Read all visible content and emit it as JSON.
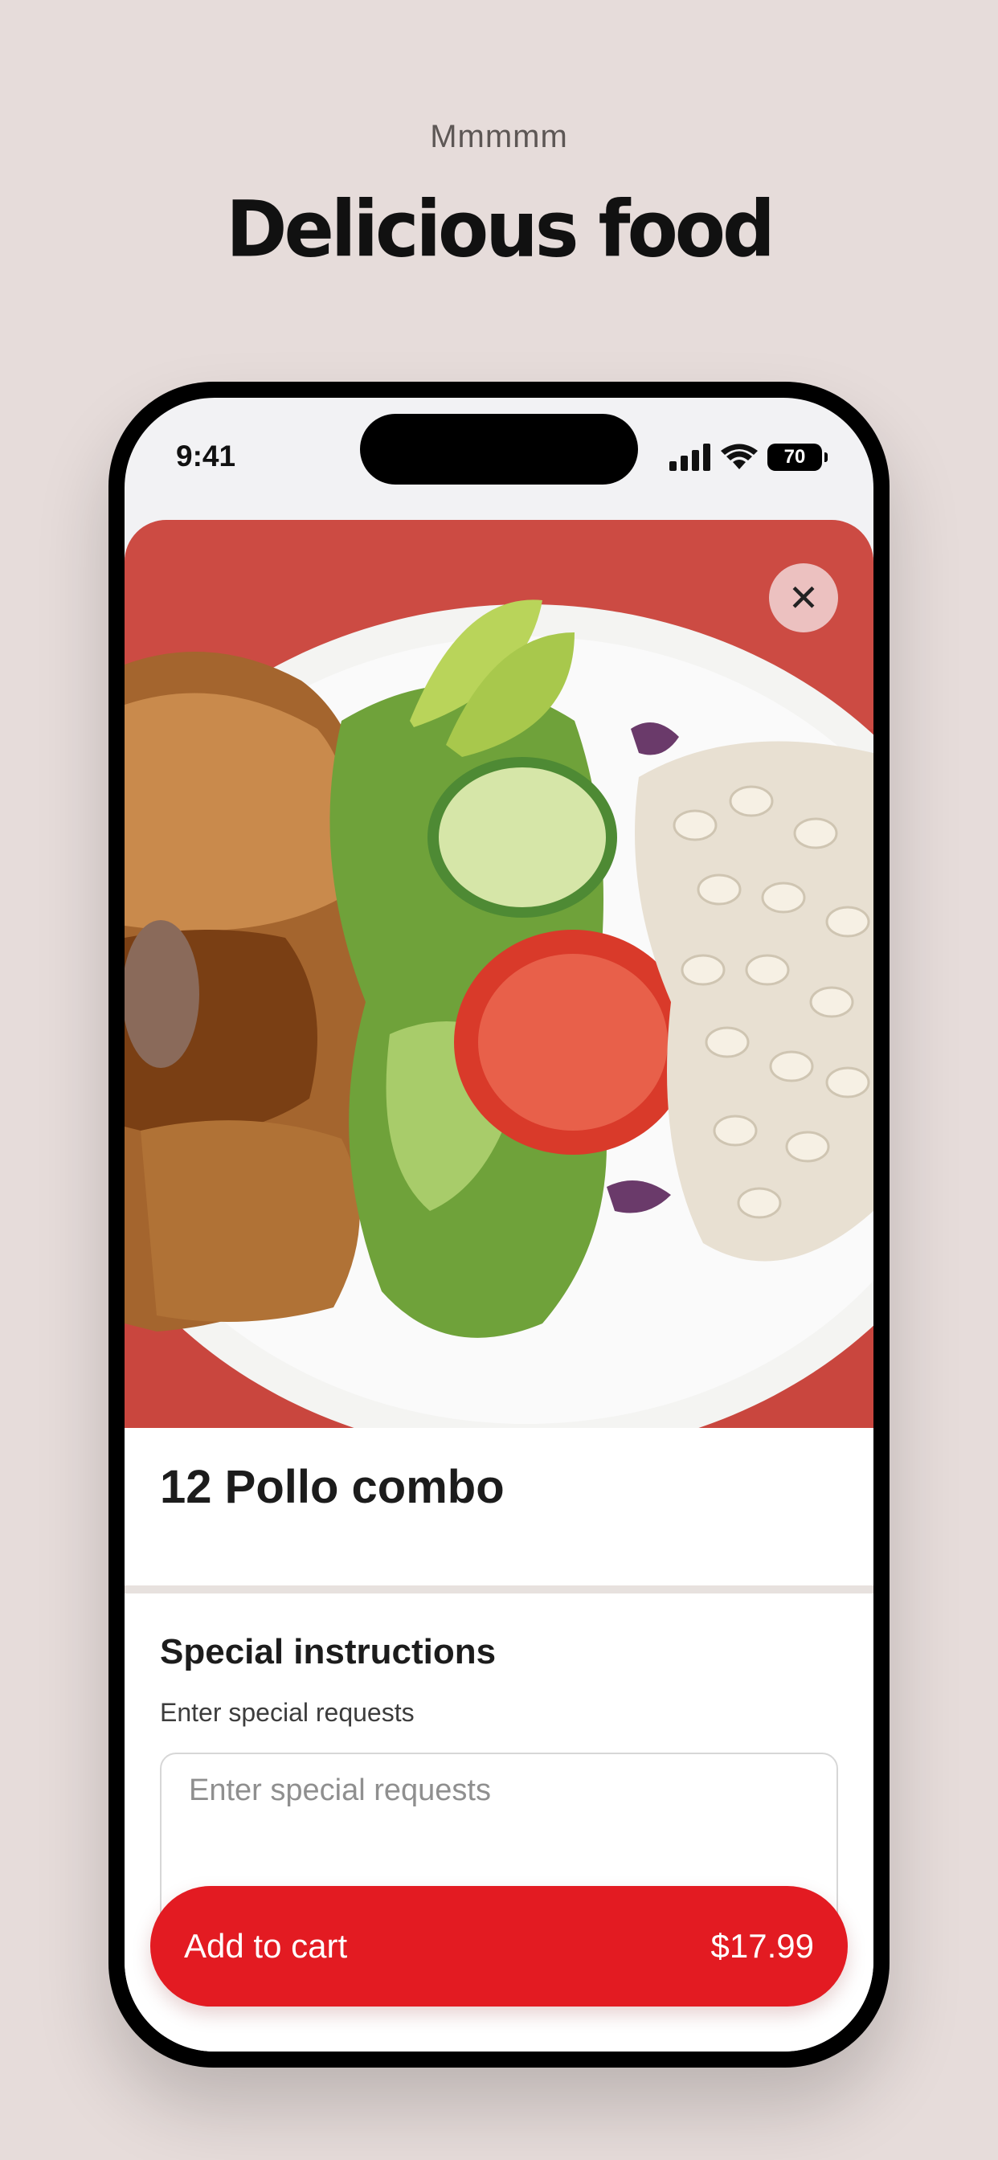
{
  "promo": {
    "eyebrow": "Mmmmm",
    "headline": "Delicious food"
  },
  "status_bar": {
    "time": "9:41",
    "battery": "70"
  },
  "item": {
    "image_icon": "food-photo",
    "close_icon": "close-icon",
    "title": "12 Pollo combo"
  },
  "special_instructions": {
    "title": "Special instructions",
    "subtitle": "Enter special requests",
    "placeholder": "Enter special requests"
  },
  "cart_button": {
    "label": "Add to cart",
    "price": "$17.99"
  },
  "colors": {
    "background": "#e6dcda",
    "accent": "#e31b22",
    "plate_background": "#c9463e"
  }
}
